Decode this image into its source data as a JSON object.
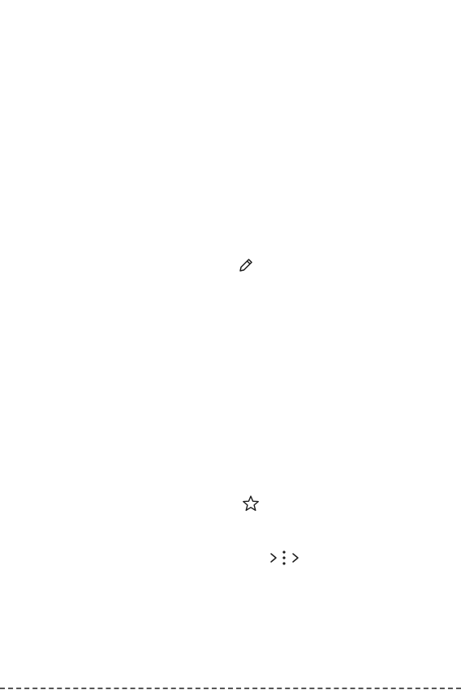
{
  "page": {
    "background": "#ffffff",
    "icon_color": "#1a1a1a"
  },
  "icons": {
    "edit": "pencil-icon",
    "favorite": "star-icon",
    "path_separator": "chevron-right-icon",
    "more_options": "more-vertical-icon"
  }
}
